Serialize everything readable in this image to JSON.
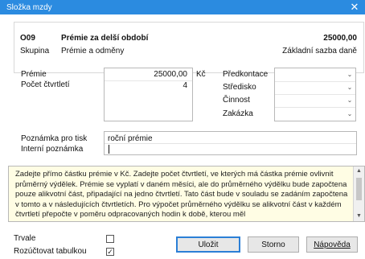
{
  "window": {
    "title": "Složka mzdy"
  },
  "header": {
    "code": "O09",
    "name": "Prémie za delší období",
    "amount": "25000,00",
    "group_label": "Skupina",
    "group_value": "Prémie a odměny",
    "basis_label": "Základní sazba daně"
  },
  "form": {
    "premium_label": "Prémie",
    "premium_value": "25000,00",
    "currency": "Kč",
    "quarters_label": "Počet čtvrtletí",
    "quarters_value": "4",
    "precontace_label": "Předkontace",
    "center_label": "Středisko",
    "activity_label": "Činnost",
    "order_label": "Zakázka",
    "print_note_label": "Poznámka pro tisk",
    "print_note_value": "roční prémie",
    "internal_note_label": "Interní poznámka",
    "internal_note_value": ""
  },
  "help": {
    "text": "Zadejte přímo částku prémie v Kč. Zadejte počet čtvrtletí, ve kterých má částka prémie ovlivnit průměrný výdělek. Prémie se vyplatí v daném měsíci, ale do průměrného výdělku bude započtena pouze alikvotní část, připadající na jedno čtvrtletí. Tato část bude v souladu se zadáním započtena v tomto a v následujících čtvrtletích. Pro výpočet průměrného výdělku se alikvotní část v každém čtvrtletí přepočte v poměru odpracovaných hodin k době, kterou měl"
  },
  "footer": {
    "trvale_label": "Trvale",
    "trvale_checked": false,
    "rozuctovat_label": "Rozúčtovat tabulkou",
    "rozuctovat_checked": true,
    "save_label": "Uložit",
    "cancel_label": "Storno",
    "help_label": "Nápověda"
  },
  "icons": {
    "close": "close-icon",
    "dropdown": "chevron-down-icon",
    "checkmark": "check-icon"
  },
  "colors": {
    "titlebar": "#2b8be0",
    "help_background": "#fffde4",
    "default_button_border": "#2b7fd6"
  }
}
